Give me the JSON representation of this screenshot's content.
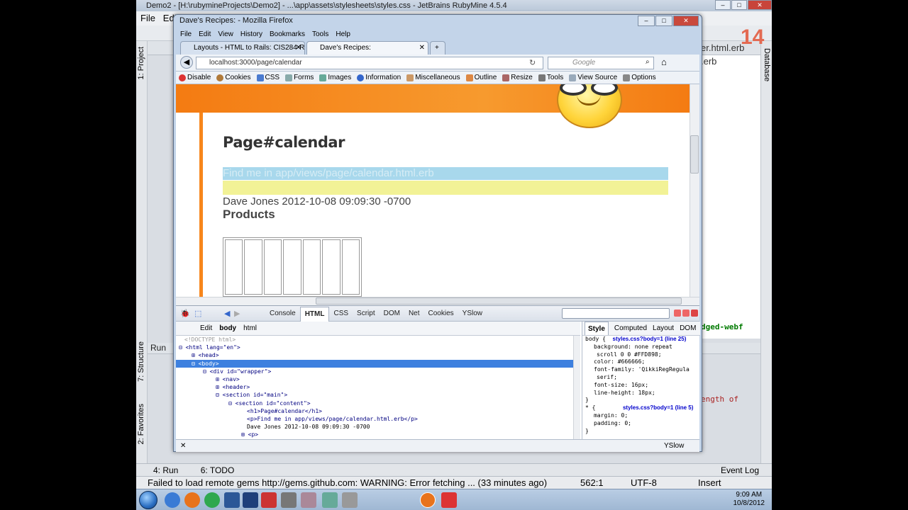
{
  "rubymine": {
    "title": "Demo2 - [H:\\rubymineProjects\\Demo2] - ...\\app\\assets\\stylesheets\\styles.css - JetBrains RubyMine 4.5.4",
    "menu": [
      "File",
      "Edit"
    ],
    "left_panel": {
      "project": "1: Project",
      "structure": "7: Structure",
      "favorites": "2: Favorites"
    },
    "right_panel": {
      "database": "Database"
    },
    "editor_tab": "er.html.erb",
    "editor_tab2": ".erb",
    "step_number": "14",
    "code_snippet_1": "dged-webf",
    "code_snippet_2": "ength of",
    "run_label": "Run",
    "bottom_tabs": {
      "run": "4: Run",
      "todo": "6: TODO",
      "event_log": "Event Log"
    },
    "status": {
      "message": "Failed to load remote gems http://gems.github.com: WARNING:  Error fetching ... (33 minutes ago)",
      "position": "562:1",
      "encoding": "UTF-8",
      "mode": "Insert"
    }
  },
  "firefox": {
    "title": "Dave's Recipes: - Mozilla Firefox",
    "menu": [
      "File",
      "Edit",
      "View",
      "History",
      "Bookmarks",
      "Tools",
      "Help"
    ],
    "tabs": [
      {
        "label": "Layouts - HTML to Rails: CIS284-Rub..."
      },
      {
        "label": "Dave's Recipes:"
      }
    ],
    "url": "localhost:3000/page/calendar",
    "search_placeholder": "Google",
    "webdev_toolbar": [
      "Disable",
      "Cookies",
      "CSS",
      "Forms",
      "Images",
      "Information",
      "Miscellaneous",
      "Outline",
      "Resize",
      "Tools",
      "View Source",
      "Options"
    ]
  },
  "page": {
    "heading": "Page#calendar",
    "find_me": "Find me in app/views/page/calendar.html.erb",
    "author_line": "Dave Jones 2012-10-08 09:09:30 -0700",
    "products": "Products"
  },
  "firebug": {
    "tabs": [
      "Console",
      "HTML",
      "CSS",
      "Script",
      "DOM",
      "Net",
      "Cookies",
      "YSlow"
    ],
    "active_tab": "HTML",
    "breadcrumb": {
      "edit": "Edit",
      "body": "body",
      "html": "html"
    },
    "side_tabs": [
      "Style",
      "Computed",
      "Layout",
      "DOM"
    ],
    "tree": [
      "<!DOCTYPE html>",
      "<html lang=\"en\">",
      "<head>",
      "<body>",
      "<div id=\"wrapper\">",
      "<nav>",
      "<header>",
      "<section id=\"main\">",
      "<section id=\"content\">",
      "<h1>Page#calendar</h1>",
      "<p>Find me in app/views/page/calendar.html.erb</p>",
      "Dave Jones 2012-10-08 09:09:30 -0700",
      "<p>"
    ],
    "css": {
      "rule1_selector": "body {",
      "rule1_source": "styles.css?body=1 (line 25)",
      "rule1_props": [
        "background: none repeat",
        "scroll 0 0 #FFD898;",
        "color: #666666;",
        "font-family: 'QikkiRegRegula",
        "serif;",
        "font-size: 16px;",
        "line-height: 18px;"
      ],
      "rule2_selector": "* {",
      "rule2_source": "styles.css?body=1 (line 5)",
      "rule2_props": [
        "margin: 0;",
        "padding: 0;"
      ],
      "close": "}"
    },
    "status_yslow": "YSlow"
  },
  "taskbar": {
    "time": "9:09 AM",
    "date": "10/8/2012"
  }
}
